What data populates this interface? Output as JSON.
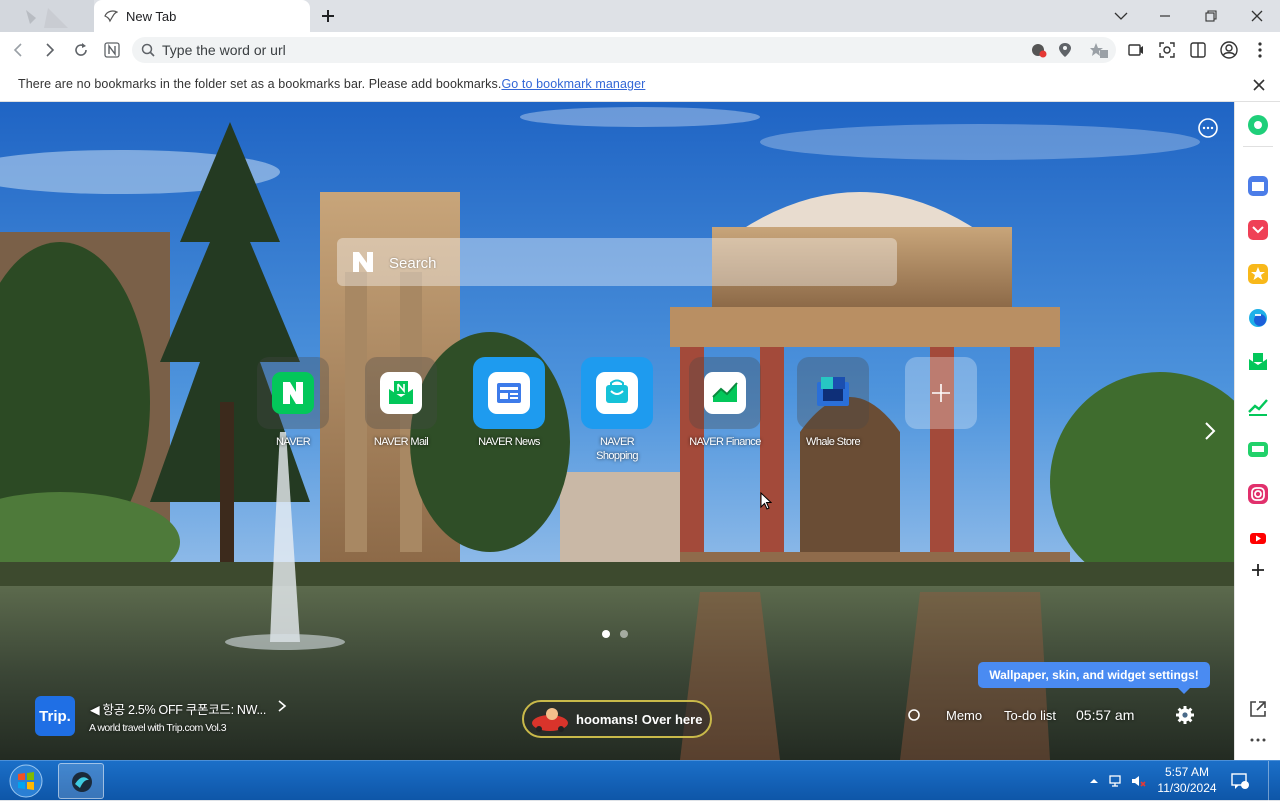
{
  "tab": {
    "title": "New Tab",
    "new_tab": "+"
  },
  "address": {
    "placeholder": "Type the word or url"
  },
  "bookmark_bar": {
    "message": "There are no bookmarks in the folder set as a bookmarks bar. Please add bookmarks.",
    "link": "Go to bookmark manager"
  },
  "search": {
    "placeholder": "Search"
  },
  "shortcuts": [
    {
      "label": "NAVER",
      "color": "#03c75a"
    },
    {
      "label": "NAVER Mail",
      "color": "#ffffff"
    },
    {
      "label": "NAVER News",
      "color": "#ffffff"
    },
    {
      "label": "NAVER\nShopping",
      "color": "#ffffff"
    },
    {
      "label": "NAVER Finance",
      "color": "#ffffff"
    },
    {
      "label": "Whale Store",
      "color": "#2a6fd8"
    }
  ],
  "trip": {
    "badge": "Trip.",
    "title": "◀ 항공 2.5% OFF 쿠폰코드: NW...",
    "subtitle": "A world travel with Trip.com Vol.3"
  },
  "hoomans": {
    "label": "hoomans! Over here"
  },
  "widgets": {
    "memo": "Memo",
    "todo": "To-do list",
    "time": "05:57 am"
  },
  "tooltip": "Wallpaper, skin, and widget settings!",
  "taskbar": {
    "time": "5:57 AM",
    "date": "11/30/2024"
  },
  "sidebar_icons": [
    "whale-icon",
    "calendar-icon",
    "pocket-icon",
    "favorites-icon",
    "translate-icon",
    "naver-mail-icon",
    "finance-icon",
    "papago-icon",
    "instagram-icon",
    "youtube-icon",
    "add-icon"
  ]
}
